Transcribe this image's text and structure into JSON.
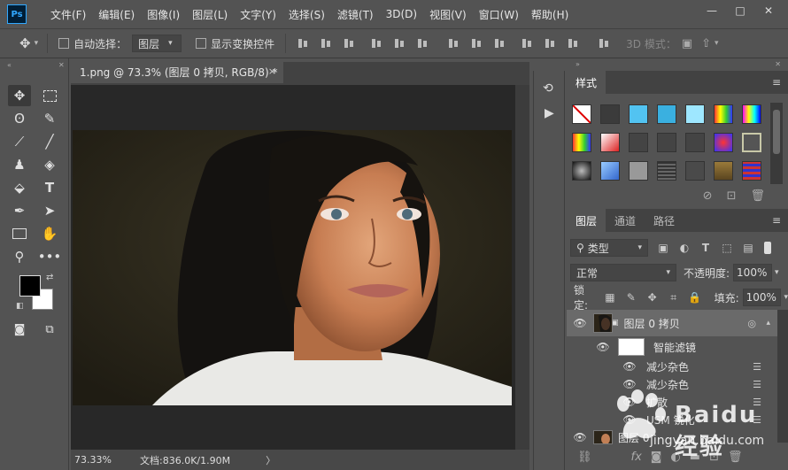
{
  "menubar": {
    "logo": "Ps",
    "items": [
      "文件(F)",
      "编辑(E)",
      "图像(I)",
      "图层(L)",
      "文字(Y)",
      "选择(S)",
      "滤镜(T)",
      "3D(D)",
      "视图(V)",
      "窗口(W)",
      "帮助(H)"
    ],
    "window_buttons": [
      "—",
      "□",
      "✕"
    ]
  },
  "options": {
    "auto_select_label": "自动选择：",
    "auto_select_value": "图层",
    "show_transform_label": "显示变换控件",
    "mode_3d_label": "3D 模式："
  },
  "document": {
    "tab_title": "1.png @ 73.3% (图层 0 拷贝, RGB/8) *",
    "close": "×",
    "zoom": "73.33%",
    "doc_size": "文档:836.0K/1.90M",
    "status_arrow": "〉"
  },
  "styles_panel": {
    "tab": "样式",
    "menu_icon": "≡"
  },
  "layers_panel": {
    "tabs": [
      "图层",
      "通道",
      "路径"
    ],
    "filter_kind": "类型",
    "blend_mode": "正常",
    "opacity_label": "不透明度:",
    "opacity_value": "100%",
    "lock_label": "锁定:",
    "fill_label": "填充:",
    "fill_value": "100%",
    "layers": [
      {
        "name": "图层 0 拷贝"
      },
      {
        "name": "智能滤镜"
      },
      {
        "name": "减少杂色"
      },
      {
        "name": "减少杂色"
      },
      {
        "name": "扩散"
      },
      {
        "name": "USM 锐化"
      },
      {
        "name": "图层 0"
      }
    ]
  },
  "watermark": {
    "text": "Baidu 经验",
    "url": "jingyan.baidu.com"
  }
}
